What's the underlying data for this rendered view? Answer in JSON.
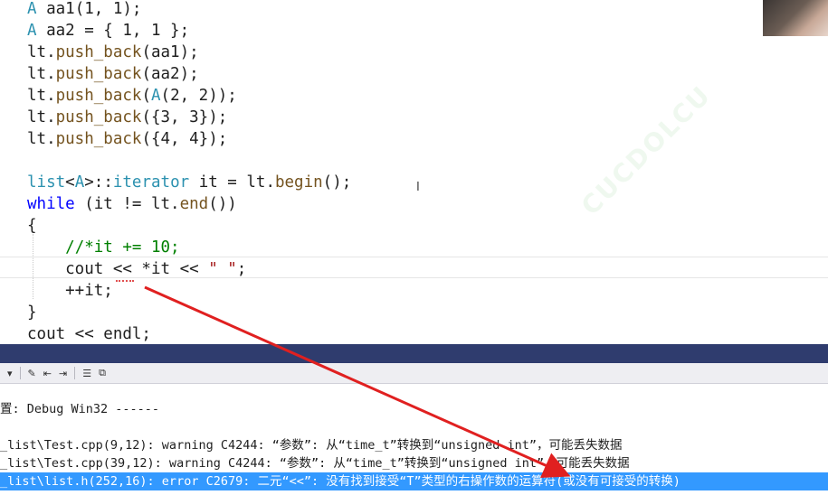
{
  "editor": {
    "lines": [
      [
        {
          "t": "A",
          "c": "ty"
        },
        {
          "t": " aa1(1, 1);"
        }
      ],
      [
        {
          "t": "A",
          "c": "ty"
        },
        {
          "t": " aa2 = { 1, 1 };"
        }
      ],
      [
        {
          "t": "lt."
        },
        {
          "t": "push_back",
          "c": "fn"
        },
        {
          "t": "(aa1);"
        }
      ],
      [
        {
          "t": "lt."
        },
        {
          "t": "push_back",
          "c": "fn"
        },
        {
          "t": "(aa2);"
        }
      ],
      [
        {
          "t": "lt."
        },
        {
          "t": "push_back",
          "c": "fn"
        },
        {
          "t": "("
        },
        {
          "t": "A",
          "c": "ty"
        },
        {
          "t": "(2, 2));"
        }
      ],
      [
        {
          "t": "lt."
        },
        {
          "t": "push_back",
          "c": "fn"
        },
        {
          "t": "({3, 3});"
        }
      ],
      [
        {
          "t": "lt."
        },
        {
          "t": "push_back",
          "c": "fn"
        },
        {
          "t": "({4, 4});"
        }
      ],
      [],
      [
        {
          "t": "list",
          "c": "ty"
        },
        {
          "t": "<"
        },
        {
          "t": "A",
          "c": "ty"
        },
        {
          "t": ">::"
        },
        {
          "t": "iterator",
          "c": "ty"
        },
        {
          "t": " it = lt."
        },
        {
          "t": "begin",
          "c": "fn"
        },
        {
          "t": "();"
        }
      ],
      [
        {
          "t": "while",
          "c": "kw"
        },
        {
          "t": " (it != lt."
        },
        {
          "t": "end",
          "c": "fn"
        },
        {
          "t": "())"
        }
      ],
      [
        {
          "t": "{"
        }
      ],
      [
        {
          "t": "    "
        },
        {
          "t": "//*it += 10;",
          "c": "cm"
        }
      ],
      [
        {
          "t": "    cout << *it << "
        },
        {
          "t": "\" \"",
          "c": "st"
        },
        {
          "t": ";"
        }
      ],
      [
        {
          "t": "    ++it;"
        }
      ],
      [
        {
          "t": "}"
        }
      ],
      [
        {
          "t": "cout << endl;"
        }
      ]
    ]
  },
  "watermark": "CUCDOLCU",
  "toolbar": {
    "items": [
      "▾",
      "✎",
      "⇤",
      "⇥",
      "☰",
      "⧉"
    ]
  },
  "output": {
    "lines": [
      "置: Debug Win32 ------",
      "",
      "_list\\Test.cpp(9,12): warning C4244: “参数”: 从“time_t”转换到“unsigned int”，可能丢失数据",
      "_list\\Test.cpp(39,12): warning C4244: “参数”: 从“time_t”转换到“unsigned int”，可能丢失数据",
      "_list\\list.h(252,16): error C2679: 二元“<<”: 没有找到接受“T”类型的右操作数的运算符(或没有可接受的转换)"
    ],
    "selected_index": 4
  },
  "colors": {
    "panel_header": "#2f3c6e",
    "selection": "#3399ff",
    "annotation_arrow": "#e02020"
  }
}
